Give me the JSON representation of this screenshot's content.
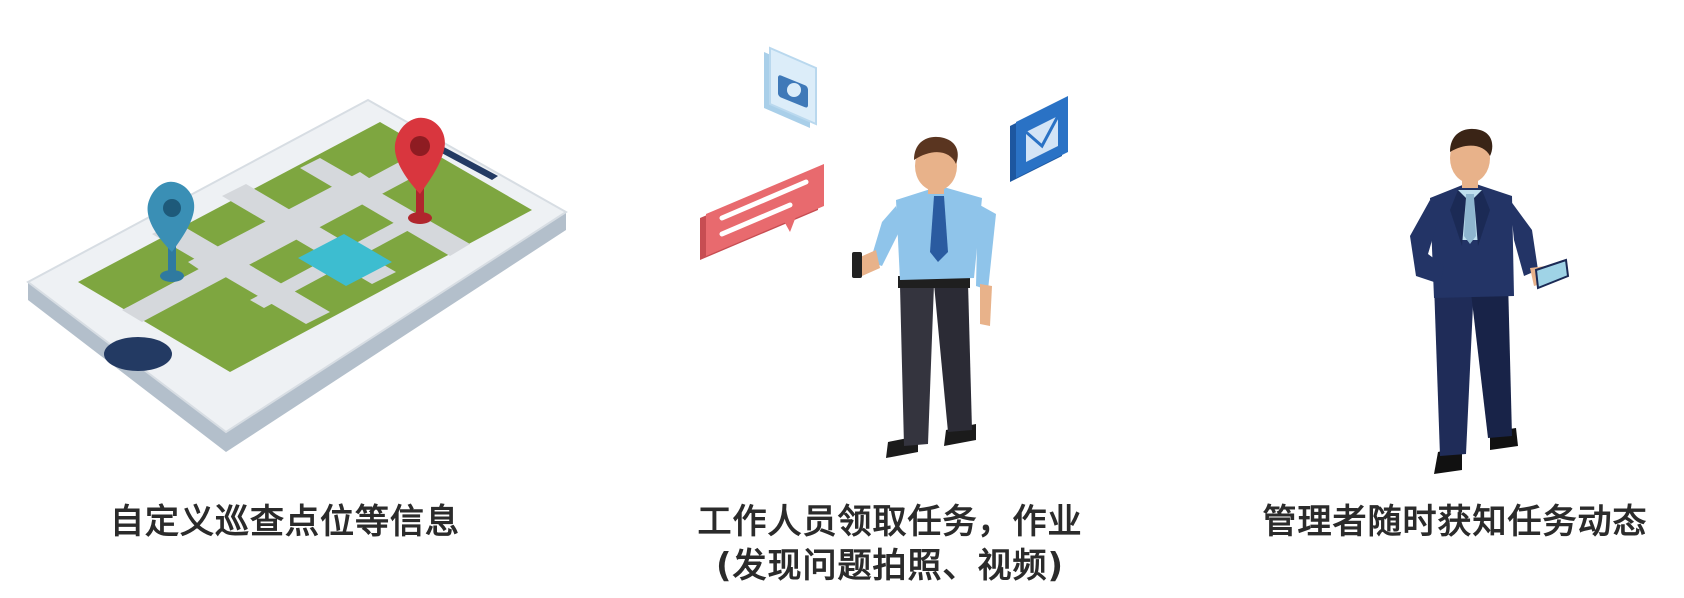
{
  "panels": [
    {
      "id": "custom-points",
      "caption_lines": [
        "自定义巡查点位等信息"
      ]
    },
    {
      "id": "worker-task",
      "caption_lines": [
        "工作人员领取任务，作业",
        "(发现问题拍照、视频)"
      ]
    },
    {
      "id": "manager-status",
      "caption_lines": [
        "管理者随时获知任务动态"
      ]
    }
  ],
  "colors": {
    "map_green": "#7ea640",
    "phone_body": "#e9edf1",
    "pin_red": "#d9363e",
    "pin_blue": "#3a8fb5",
    "shirt_blue": "#8fc4ea",
    "suit_navy": "#233466",
    "chat_red": "#e86a6e",
    "mail_blue": "#2a72c5",
    "camera_blue": "#cfe6f6"
  },
  "icons": [
    "map-pin-icon",
    "camera-icon",
    "chat-bubble-icon",
    "mail-icon",
    "smartphone-icon"
  ]
}
